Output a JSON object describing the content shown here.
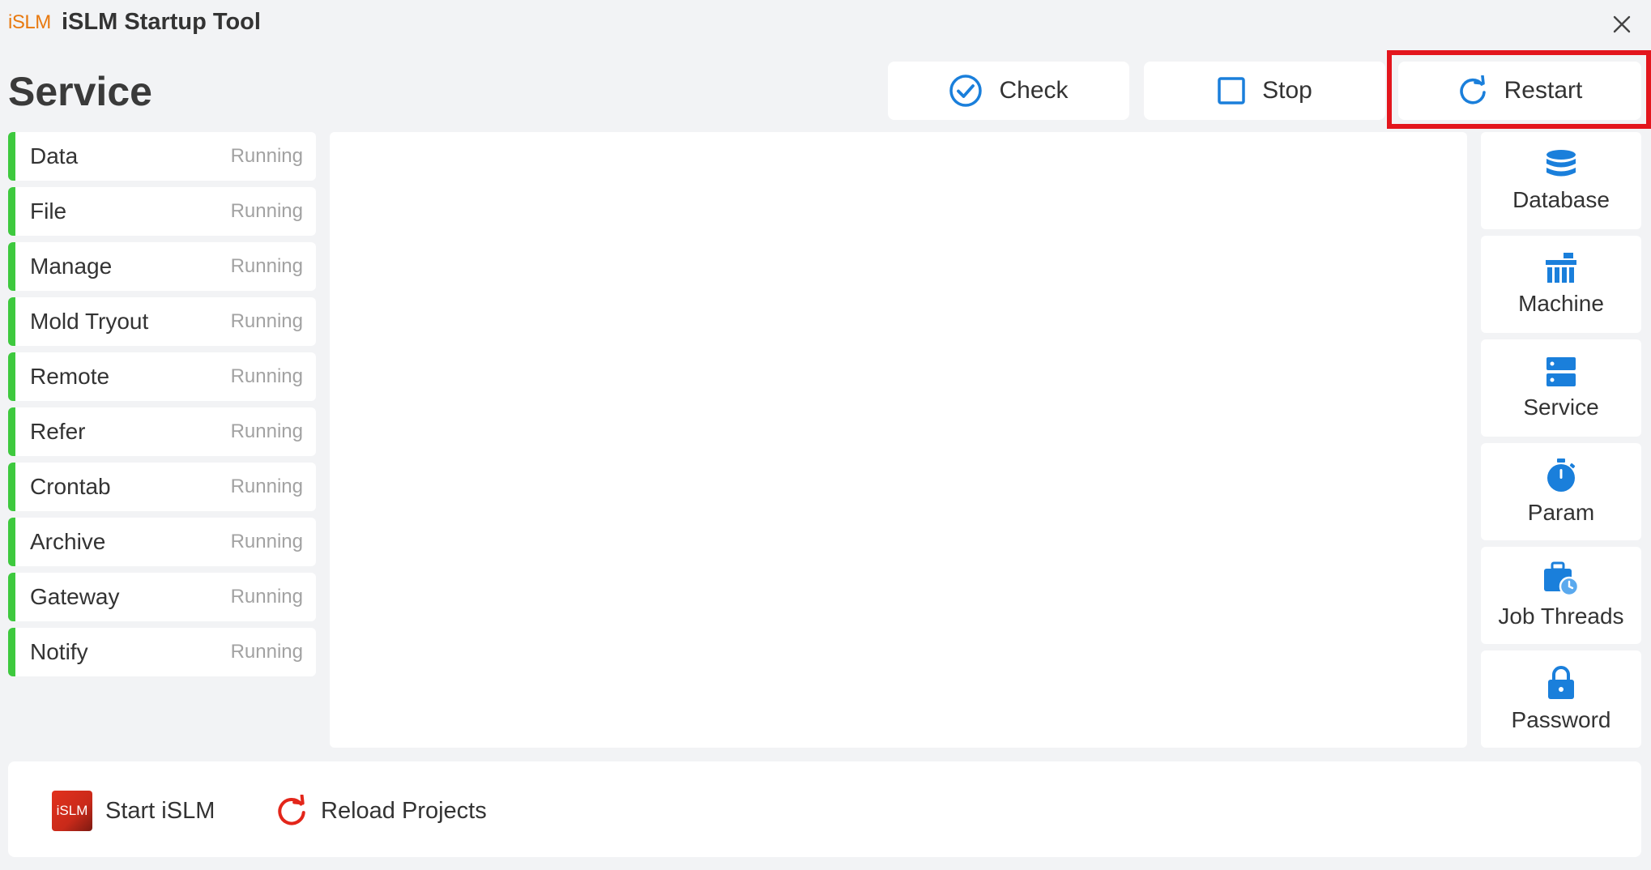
{
  "window": {
    "logo_text": "iSLM",
    "title": "iSLM Startup Tool",
    "close_icon": "close-icon"
  },
  "page": {
    "title": "Service"
  },
  "actions": {
    "check": {
      "label": "Check",
      "icon": "check-circle-icon"
    },
    "stop": {
      "label": "Stop",
      "icon": "stop-square-icon"
    },
    "restart": {
      "label": "Restart",
      "icon": "refresh-icon",
      "highlighted": true
    }
  },
  "services": [
    {
      "name": "Data",
      "status": "Running"
    },
    {
      "name": "File",
      "status": "Running"
    },
    {
      "name": "Manage",
      "status": "Running"
    },
    {
      "name": "Mold Tryout",
      "status": "Running"
    },
    {
      "name": "Remote",
      "status": "Running"
    },
    {
      "name": "Refer",
      "status": "Running"
    },
    {
      "name": "Crontab",
      "status": "Running"
    },
    {
      "name": "Archive",
      "status": "Running"
    },
    {
      "name": "Gateway",
      "status": "Running"
    },
    {
      "name": "Notify",
      "status": "Running"
    }
  ],
  "sidebar": [
    {
      "label": "Database",
      "icon": "database-icon"
    },
    {
      "label": "Machine",
      "icon": "machine-icon"
    },
    {
      "label": "Service",
      "icon": "server-icon"
    },
    {
      "label": "Param",
      "icon": "stopwatch-icon"
    },
    {
      "label": "Job Threads",
      "icon": "briefcase-clock-icon"
    },
    {
      "label": "Password",
      "icon": "lock-icon"
    }
  ],
  "footer": {
    "start": {
      "label": "Start iSLM",
      "icon_text": "iSLM",
      "icon": "islm-app-icon"
    },
    "reload": {
      "label": "Reload Projects",
      "icon": "reload-icon"
    }
  },
  "colors": {
    "accent": "#1a7fdb",
    "running": "#3ec93e",
    "highlight": "#e3161d",
    "logo": "#e8790f",
    "reload": "#e3261a"
  }
}
